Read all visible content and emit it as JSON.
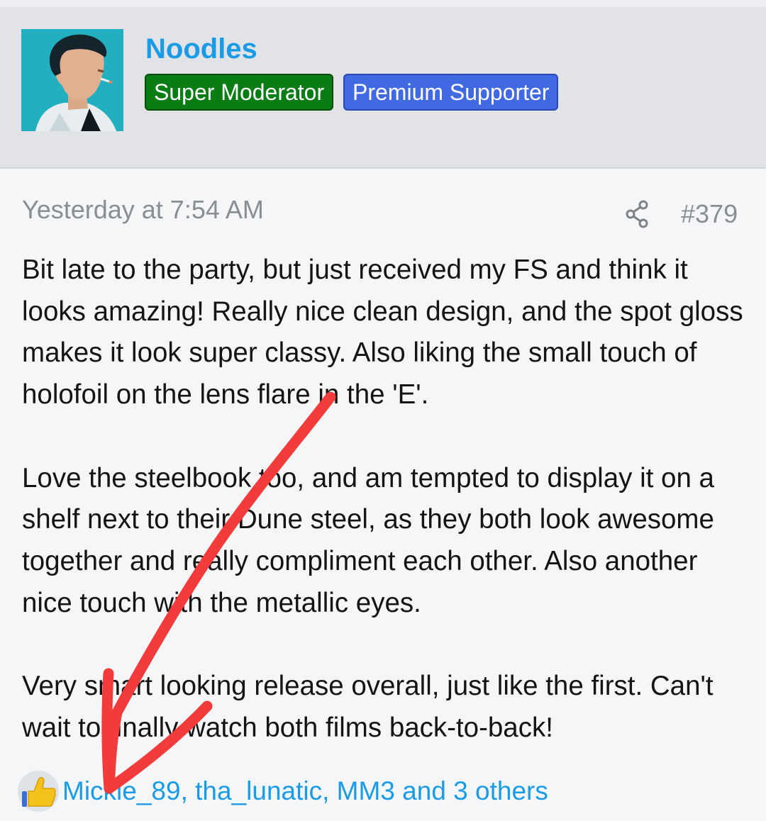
{
  "user": {
    "name": "Noodles",
    "badges": [
      {
        "label": "Super Moderator",
        "color": "#0a7c14"
      },
      {
        "label": "Premium Supporter",
        "color": "#4169e1"
      }
    ]
  },
  "post": {
    "timestamp": "Yesterday at 7:54 AM",
    "number": "#379",
    "paragraphs": [
      "Bit late to the party, but just received my FS and think it looks amazing! Really nice clean design, and the spot gloss makes it look super classy. Also liking the small touch of holofoil on the lens flare in the 'E'.",
      "Love the steelbook too, and am tempted to display it on a shelf next to their Dune steel, as they both look awesome together and really compliment each other. Also another nice touch with the metallic eyes.",
      "Very smart looking release overall, just like the first. Can't wait to finally watch both films back-to-back!"
    ]
  },
  "reactions": {
    "icon": "thumbs-up-icon",
    "text": "Mickle_89, tha_lunatic, MM3 and 3 others"
  },
  "icons": {
    "share": "share-icon",
    "annotation": "red-arrow-icon"
  },
  "colors": {
    "link": "#1a9be6",
    "annotation": "#f23b3b",
    "header_bg": "#e2e3e6"
  }
}
